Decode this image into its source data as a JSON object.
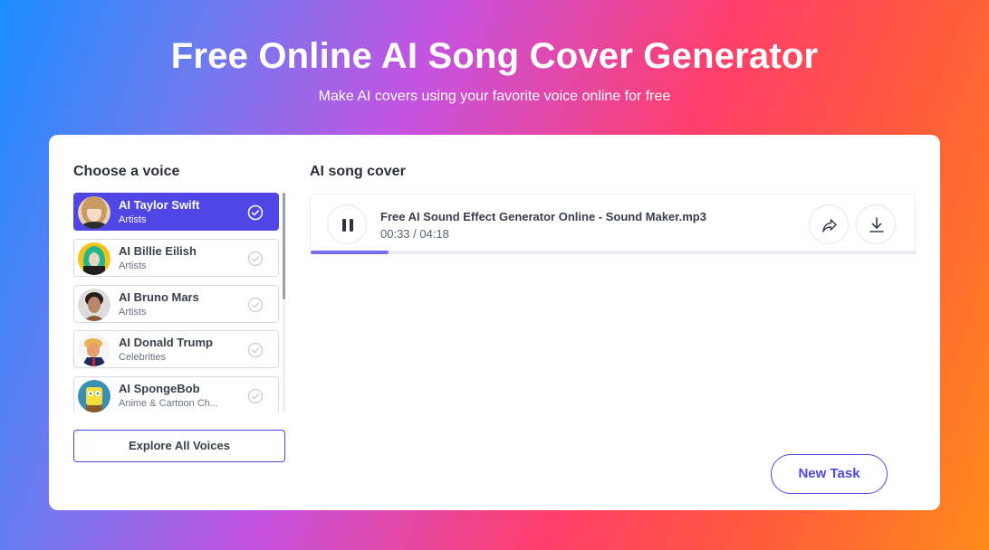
{
  "hero": {
    "title": "Free Online AI Song Cover Generator",
    "subtitle": "Make AI covers using your favorite voice online for free"
  },
  "voices": {
    "title": "Choose a voice",
    "items": [
      {
        "name": "AI Taylor Swift",
        "category": "Artists",
        "selected": true
      },
      {
        "name": "AI Billie Eilish",
        "category": "Artists",
        "selected": false
      },
      {
        "name": "AI Bruno Mars",
        "category": "Artists",
        "selected": false
      },
      {
        "name": "AI Donald Trump",
        "category": "Celebrities",
        "selected": false
      },
      {
        "name": "AI SpongeBob",
        "category": "Anime & Cartoon Ch...",
        "selected": false
      }
    ],
    "explore_label": "Explore All Voices"
  },
  "cover": {
    "title": "AI song cover",
    "track_name": "Free AI Sound Effect Generator Online - Sound Maker.mp3",
    "time": "00:33 / 04:18",
    "progress_fraction": 0.128,
    "state": "playing"
  },
  "new_task_label": "New Task",
  "colors": {
    "accent": "#4f46e5",
    "progress": "#7c6cf0"
  },
  "icons": [
    "pause-icon",
    "share-icon",
    "download-icon",
    "check-circle-icon"
  ]
}
